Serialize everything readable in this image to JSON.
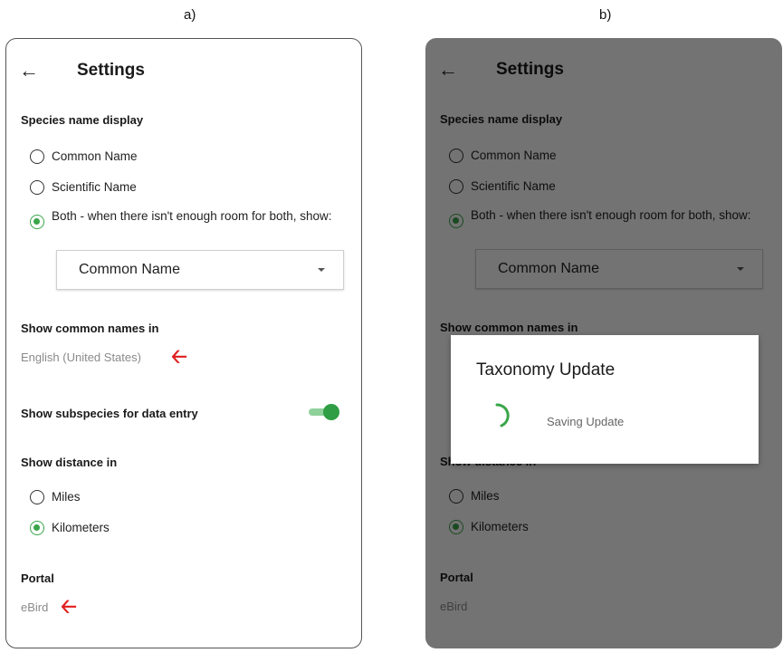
{
  "labels": {
    "a": "a)",
    "b": "b)"
  },
  "settings": {
    "title": "Settings",
    "species_section": "Species name display",
    "species_options": [
      "Common Name",
      "Scientific Name",
      "Both - when there isn't enough room for both, show:"
    ],
    "species_selected_index": 2,
    "dropdown_value": "Common Name",
    "common_names_section": "Show common names in",
    "common_names_value": "English (United States)",
    "subspecies_label": "Show subspecies for data entry",
    "subspecies_enabled": true,
    "distance_section": "Show distance in",
    "distance_options": [
      "Miles",
      "Kilometers"
    ],
    "distance_selected_index": 1,
    "portal_section": "Portal",
    "portal_value": "eBird"
  },
  "dialog": {
    "title": "Taxonomy Update",
    "message": "Saving Update"
  },
  "colors": {
    "accent": "#3aa54a",
    "annotation_arrow": "#e01e1e"
  },
  "icons": {
    "back": "arrow-left-icon",
    "annotation": "red-arrow-left-icon"
  }
}
